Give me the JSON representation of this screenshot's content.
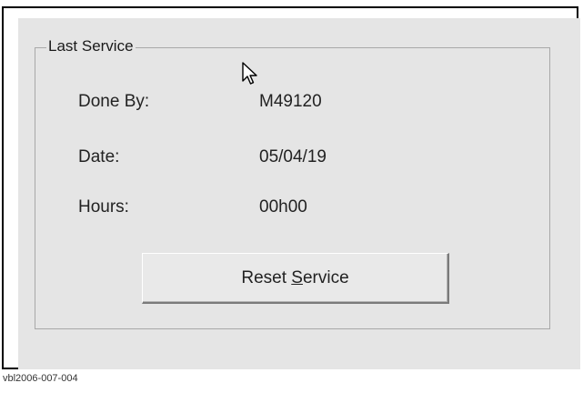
{
  "group": {
    "title": "Last Service"
  },
  "fields": {
    "done_by": {
      "label": "Done By:",
      "value": "M49120"
    },
    "date": {
      "label": "Date:",
      "value": "05/04/19"
    },
    "hours": {
      "label": "Hours:",
      "value": "00h00"
    }
  },
  "reset_button": {
    "label_prefix": "Reset ",
    "label_mnemonic": "S",
    "label_suffix": "ervice"
  },
  "caption": "vbl2006-007-004",
  "icons": {
    "cursor": "mouse-pointer-icon"
  }
}
